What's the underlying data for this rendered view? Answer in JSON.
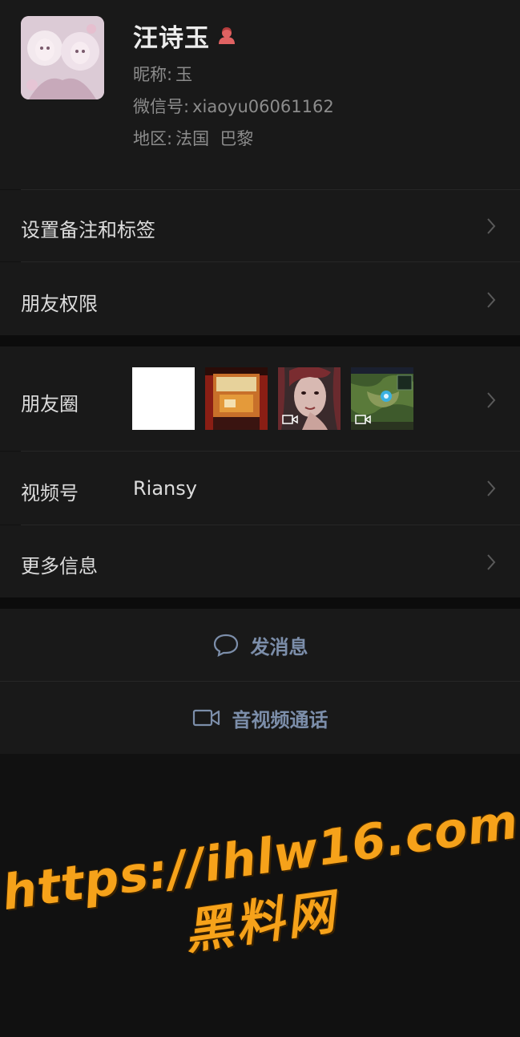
{
  "profile": {
    "name": "汪诗玉",
    "nickname_label": "昵称:",
    "nickname": "玉",
    "wechat_id_label": "微信号:",
    "wechat_id": "xiaoyu06061162",
    "region_label": "地区:",
    "region": "法国  巴黎"
  },
  "settings_rows": {
    "remark": "设置备注和标签",
    "permission": "朋友权限"
  },
  "social_rows": {
    "moments": "朋友圈",
    "channels_label": "视频号",
    "channels_value": "Riansy",
    "more_info": "更多信息"
  },
  "actions": {
    "message": "发消息",
    "call": "音视频通话"
  },
  "watermark": {
    "url": "https://ihlw16.com",
    "site_name": "黑料网"
  },
  "colors": {
    "background": "#111111",
    "card": "#191919",
    "action_text": "#7c8eaa",
    "watermark": "#f6a21a"
  }
}
